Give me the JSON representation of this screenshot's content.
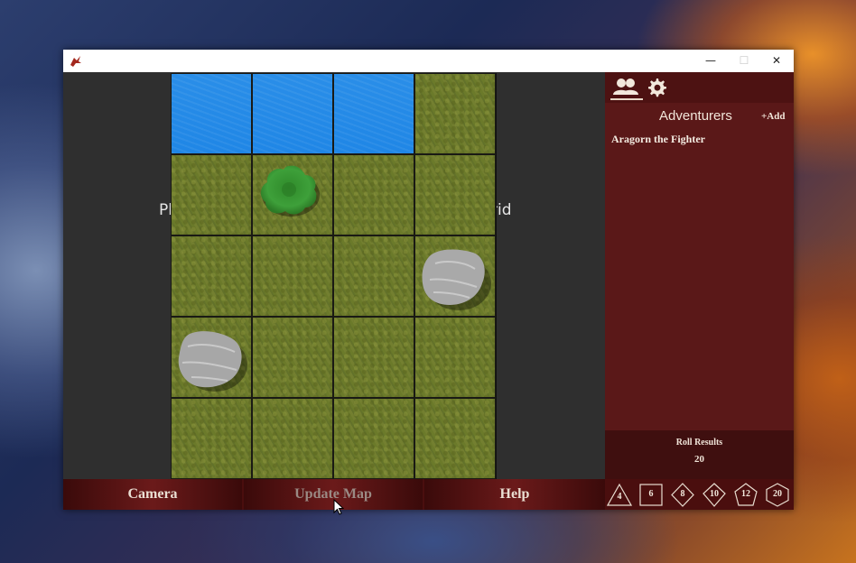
{
  "window": {
    "minimize": "—",
    "maximize": "☐",
    "close": "✕"
  },
  "map": {
    "placeholder_left": "Pl",
    "placeholder_right": "rid"
  },
  "sidebar": {
    "tabs": [
      {
        "icon": "party-icon"
      },
      {
        "icon": "gear-icon"
      }
    ],
    "title": "Adventurers",
    "add_label": "+Add",
    "adventurers": [
      "Aragorn the Fighter"
    ],
    "roll_results_label": "Roll Results",
    "roll_result_value": "20"
  },
  "toolbar": {
    "camera_label": "Camera",
    "update_map_label": "Update Map",
    "help_label": "Help"
  },
  "dice": [
    "4",
    "6",
    "8",
    "10",
    "12",
    "20"
  ],
  "colors": {
    "accent": "#5a1818",
    "toolbar": "#4a0e0e",
    "water": "#1f86e6",
    "grass": "#6b7a2a"
  }
}
